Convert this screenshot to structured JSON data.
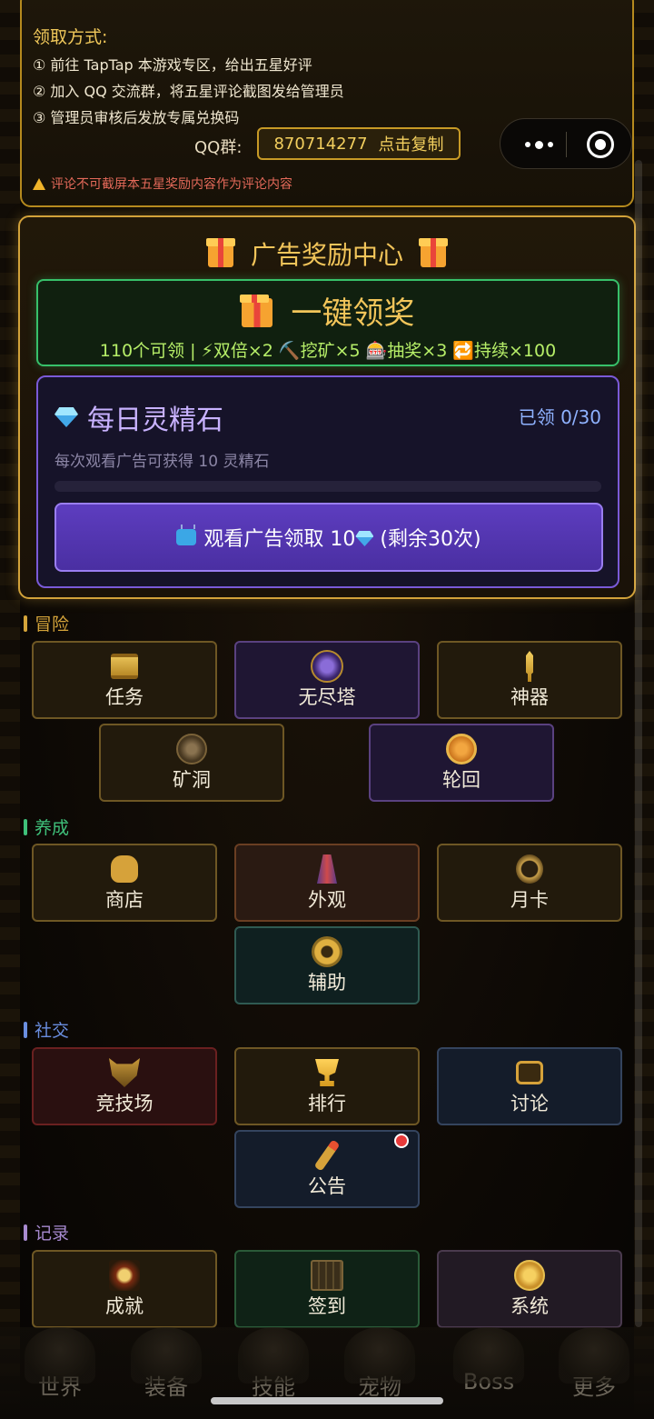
{
  "info": {
    "title": "领取方式:",
    "steps": [
      "① 前往 TapTap 本游戏专区，给出五星好评",
      "② 加入 QQ 交流群，将五星评论截图发给管理员",
      "③ 管理员审核后发放专属兑换码"
    ],
    "qq_label": "QQ群:",
    "qq_number": "870714277",
    "copy_label": "点击复制",
    "warning": "评论不可截屏本五星奖励内容作为评论内容"
  },
  "ad_center": {
    "title": "广告奖励中心",
    "claim_all_title": "一键领奖",
    "claim_all_summary": "110个可领 | ⚡双倍×2 ⛏️挖矿×5 🎰抽奖×3 🔁持续×100",
    "daily": {
      "title": "每日灵精石",
      "count": "已领 0/30",
      "desc": "每次观看广告可获得 10 灵精石",
      "progress": 0.0,
      "watch_prefix": "观看广告领取 10",
      "watch_suffix": "(剩余30次)"
    }
  },
  "sections": {
    "adventure": {
      "label": "冒险",
      "color": "#d4a43a",
      "items": [
        "任务",
        "无尽塔",
        "神器",
        "矿洞",
        "轮回"
      ]
    },
    "growth": {
      "label": "养成",
      "color": "#3fc07a",
      "items": [
        "商店",
        "外观",
        "月卡",
        "辅助"
      ]
    },
    "social": {
      "label": "社交",
      "color": "#6a8ee0",
      "items": [
        "竞技场",
        "排行",
        "讨论",
        "公告"
      ]
    },
    "records": {
      "label": "记录",
      "color": "#a78ad0",
      "items": [
        "成就",
        "签到",
        "系统"
      ]
    }
  },
  "tabs": [
    "世界",
    "装备",
    "技能",
    "宠物",
    "Boss",
    "更多"
  ],
  "colors": {
    "gold": "#f2c55a",
    "accent_green": "#37c06a",
    "accent_purple": "#7a5ad8"
  }
}
